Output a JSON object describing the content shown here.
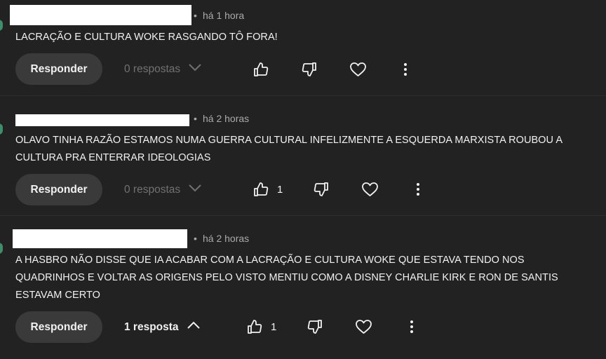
{
  "comments": [
    {
      "time": "há 1 hora",
      "text": "LACRAÇÃO E CULTURA WOKE RASGANDO TÔ FORA!",
      "reply_label": "Responder",
      "replies_label": "0 respostas",
      "like_count": ""
    },
    {
      "time": "há 2 horas",
      "text": "OLAVO TINHA RAZÃO ESTAMOS NUMA GUERRA CULTURAL INFELIZMENTE A ESQUERDA MARXISTA ROUBOU A CULTURA PRA ENTERRAR IDEOLOGIAS",
      "reply_label": "Responder",
      "replies_label": "0 respostas",
      "like_count": "1"
    },
    {
      "time": "há 2 horas",
      "text": "A HASBRO NÃO DISSE QUE IA ACABAR COM A LACRAÇÃO E CULTURA WOKE QUE  ESTAVA TENDO NOS QUADRINHOS E VOLTAR AS ORIGENS PELO VISTO MENTIU COMO A DISNEY CHARLIE KIRK E RON DE SANTIS ESTAVAM CERTO",
      "reply_label": "Responder",
      "replies_label": "1 resposta",
      "like_count": "1"
    }
  ],
  "separator": "•",
  "icons": {
    "like": "thumb-up-icon",
    "dislike": "thumb-down-icon",
    "heart": "heart-icon",
    "more": "more-vertical-icon",
    "expand": "chevron-down-icon",
    "collapse": "chevron-up-icon"
  },
  "colors": {
    "background": "#222222",
    "text": "#f1f1f1",
    "muted": "#aaaaaa",
    "button": "#3a3a3a"
  }
}
